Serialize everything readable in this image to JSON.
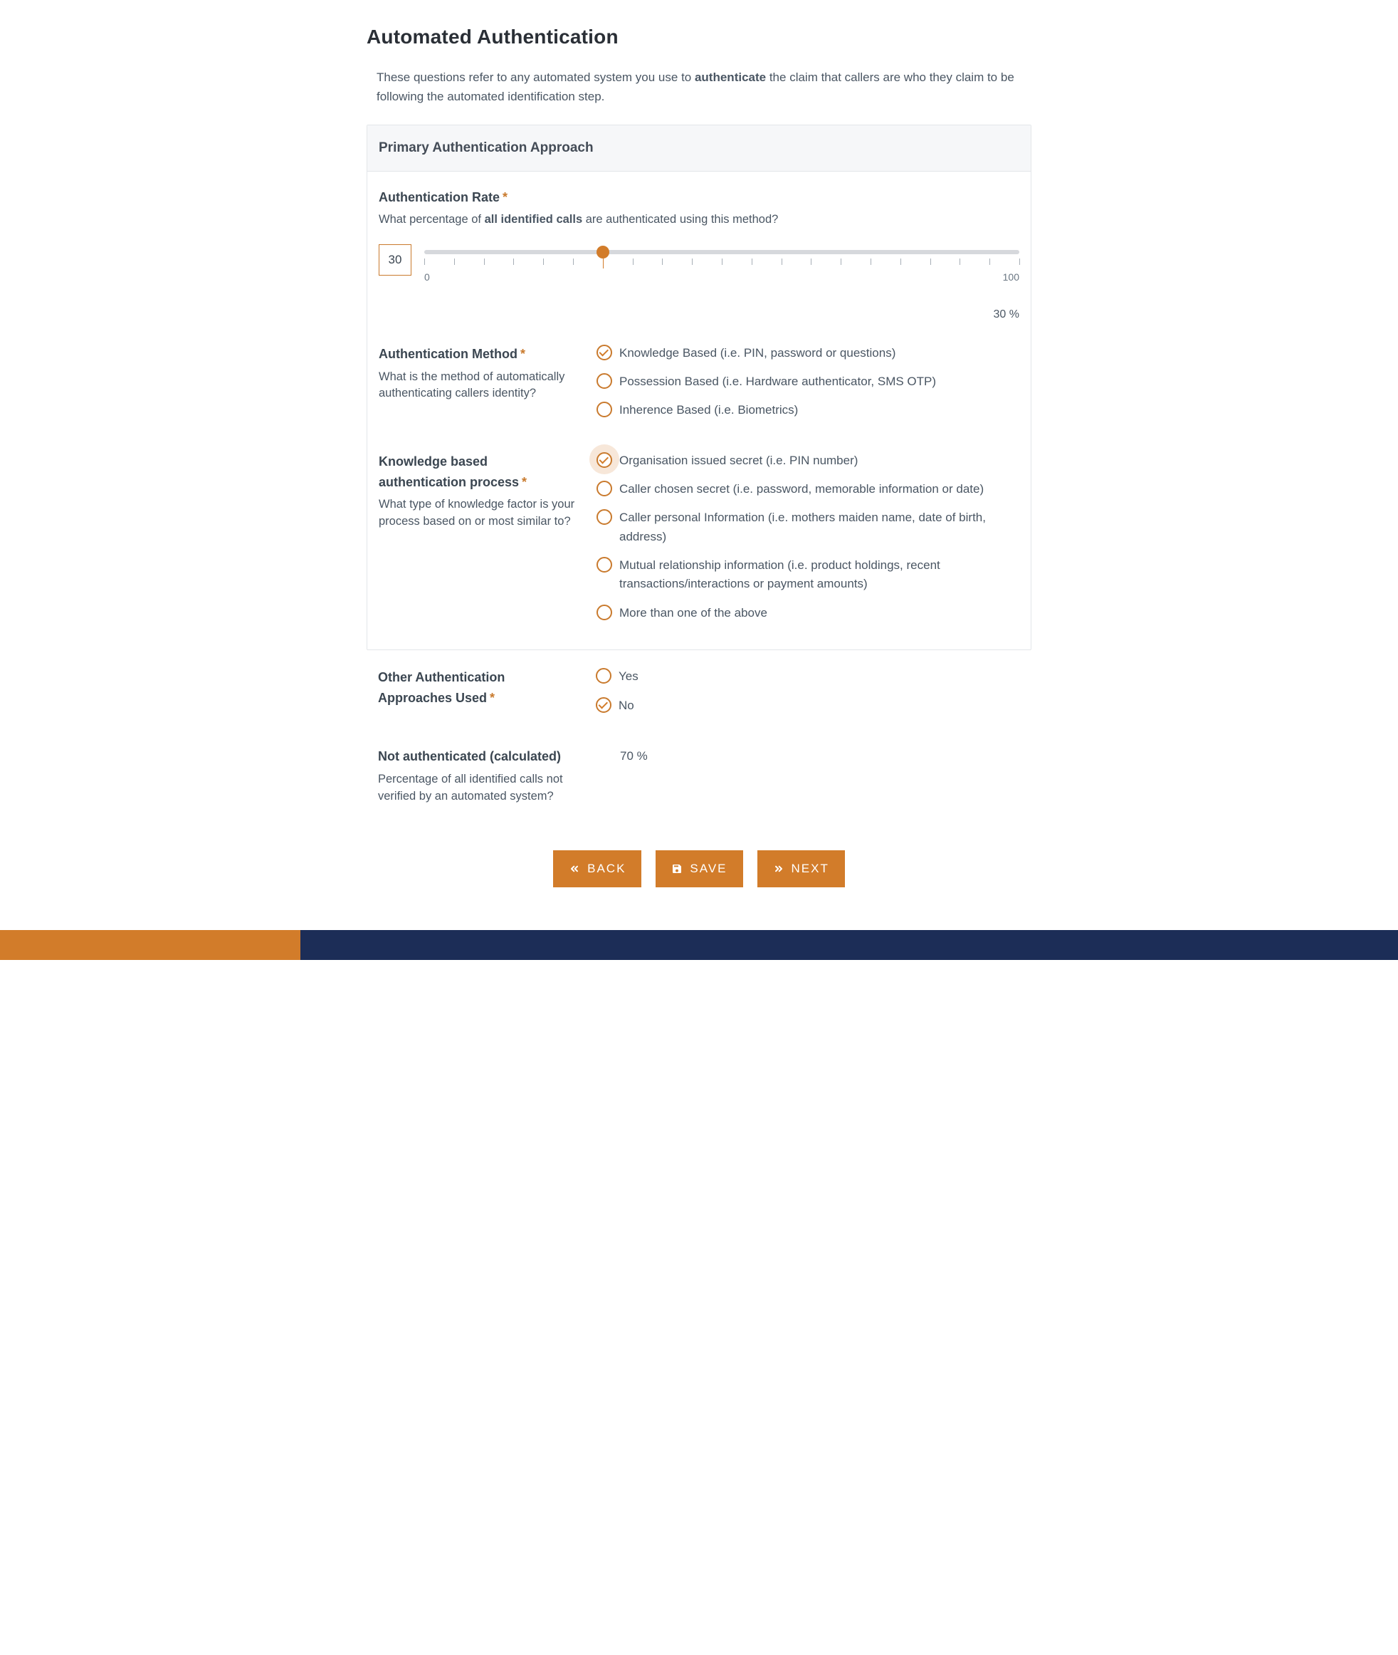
{
  "page": {
    "title": "Automated Authentication",
    "intro_prefix": "These questions refer to any automated system you use to ",
    "intro_strong": "authenticate",
    "intro_suffix": " the claim that callers are who they claim to be following the automated identification step."
  },
  "section_primary": {
    "title": "Primary Authentication Approach"
  },
  "rate": {
    "label": "Authentication Rate",
    "required": "*",
    "desc_prefix": "What percentage of ",
    "desc_strong": "all identified calls",
    "desc_suffix": " are authenticated using this method?",
    "value": "30",
    "min_label": "0",
    "max_label": "100",
    "value_pct_label": "30 %",
    "percent": 30
  },
  "method": {
    "label": "Authentication Method",
    "required": "*",
    "desc": "What is the method of automatically authenticating callers identity?",
    "selected_index": 0,
    "options": [
      "Knowledge Based (i.e. PIN, password or questions)",
      "Possession Based (i.e. Hardware authenticator, SMS OTP)",
      "Inherence Based (i.e. Biometrics)"
    ]
  },
  "kba": {
    "label": "Knowledge based authentication process",
    "required": "*",
    "desc": "What type of knowledge factor is your process based on or most similar to?",
    "selected_index": 0,
    "options": [
      "Organisation issued secret (i.e. PIN number)",
      "Caller chosen secret (i.e. password, memorable information or date)",
      "Caller personal Information (i.e. mothers maiden name, date of birth, address)",
      "Mutual relationship information (i.e. product holdings, recent transactions/interactions or payment amounts)",
      "More than one of the above"
    ]
  },
  "other": {
    "label": "Other Authentication Approaches Used",
    "required": "*",
    "selected_index": 1,
    "options": [
      "Yes",
      "No"
    ]
  },
  "not_auth": {
    "label": "Not authenticated (calculated)",
    "desc": "Percentage of all identified calls not verified by an automated system?",
    "value": "70 %"
  },
  "buttons": {
    "back": "BACK",
    "save": "SAVE",
    "next": "NEXT"
  },
  "colors": {
    "accent": "#d27c2a",
    "navy": "#1c2d57"
  }
}
